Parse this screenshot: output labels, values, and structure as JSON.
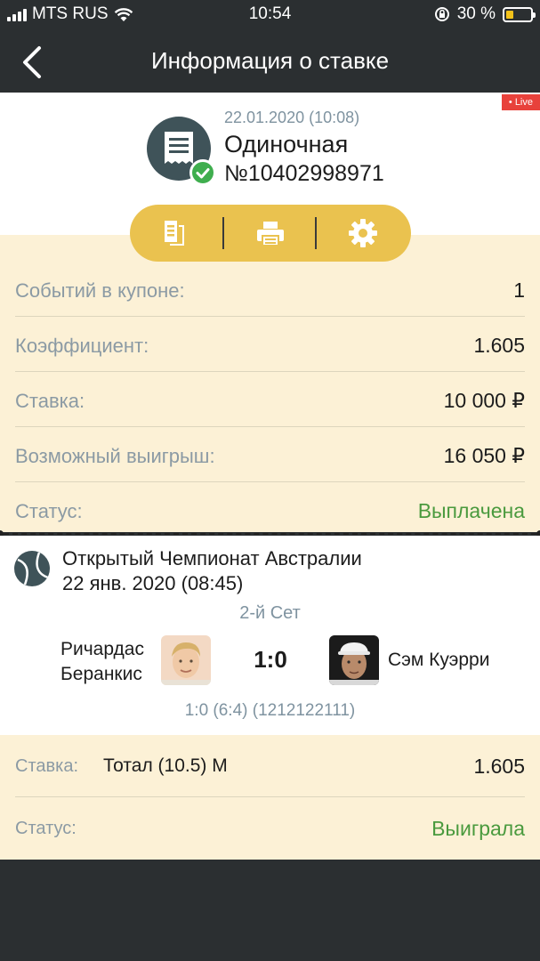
{
  "status_bar": {
    "carrier": "MTS RUS",
    "time": "10:54",
    "battery": "30 %",
    "battery_level": 0.3
  },
  "nav": {
    "title": "Информация о ставке"
  },
  "bet": {
    "live_badge": "• Live",
    "date": "22.01.2020 (10:08)",
    "type": "Одиночная",
    "number": "№10402998971"
  },
  "summary": {
    "rows": [
      {
        "label": "Событий в купоне:",
        "value": "1"
      },
      {
        "label": "Коэффициент:",
        "value": "1.605"
      },
      {
        "label": "Ставка:",
        "value": "10 000 ₽"
      },
      {
        "label": "Возможный выигрыш:",
        "value": "16 050 ₽"
      },
      {
        "label": "Статус:",
        "value": "Выплачена"
      }
    ]
  },
  "event": {
    "tournament": "Открытый Чемпионат Австралии",
    "datetime": "22 янв. 2020 (08:45)",
    "set": "2-й Сет",
    "player1_line1": "Ричардас",
    "player1_line2": "Беранкис",
    "player2": "Сэм Куэрри",
    "score": "1:0",
    "details": "1:0 (6:4) (1212122111)"
  },
  "outcome": {
    "bet_label": "Ставка:",
    "bet_value": "Тотал (10.5) М",
    "odds": "1.605",
    "status_label": "Статус:",
    "status_value": "Выиграла"
  },
  "colors": {
    "accent_yellow": "#eac24f",
    "win_green": "#4a9a3e",
    "header_dark": "#2b2f31",
    "panel_cream": "#fcf1d6"
  }
}
